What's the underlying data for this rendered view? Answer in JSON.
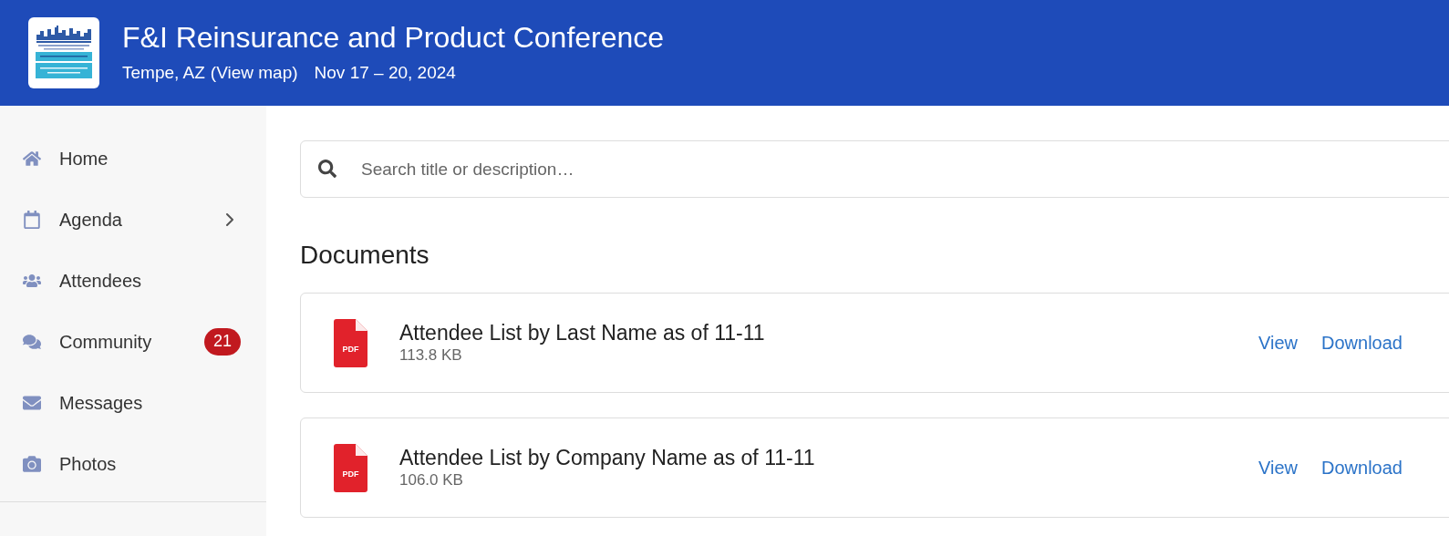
{
  "header": {
    "title": "F&I Reinsurance and Product Conference",
    "location": "Tempe, AZ",
    "map_link": "(View map)",
    "dates": "Nov 17 – 20, 2024"
  },
  "sidebar": {
    "items": [
      {
        "kind": "home",
        "label": "Home"
      },
      {
        "kind": "agenda",
        "label": "Agenda",
        "expandable": true
      },
      {
        "kind": "attendees",
        "label": "Attendees"
      },
      {
        "kind": "community",
        "label": "Community",
        "badge": "21"
      },
      {
        "kind": "messages",
        "label": "Messages"
      },
      {
        "kind": "photos",
        "label": "Photos"
      }
    ]
  },
  "search": {
    "placeholder": "Search title or description…"
  },
  "section_title": "Documents",
  "documents": [
    {
      "file_type": "PDF",
      "title": "Attendee List by Last Name as of 11-11",
      "size": "113.8 KB",
      "actions": [
        "View",
        "Download"
      ]
    },
    {
      "file_type": "PDF",
      "title": "Attendee List by Company Name as of 11-11",
      "size": "106.0 KB",
      "actions": [
        "View",
        "Download"
      ]
    }
  ]
}
